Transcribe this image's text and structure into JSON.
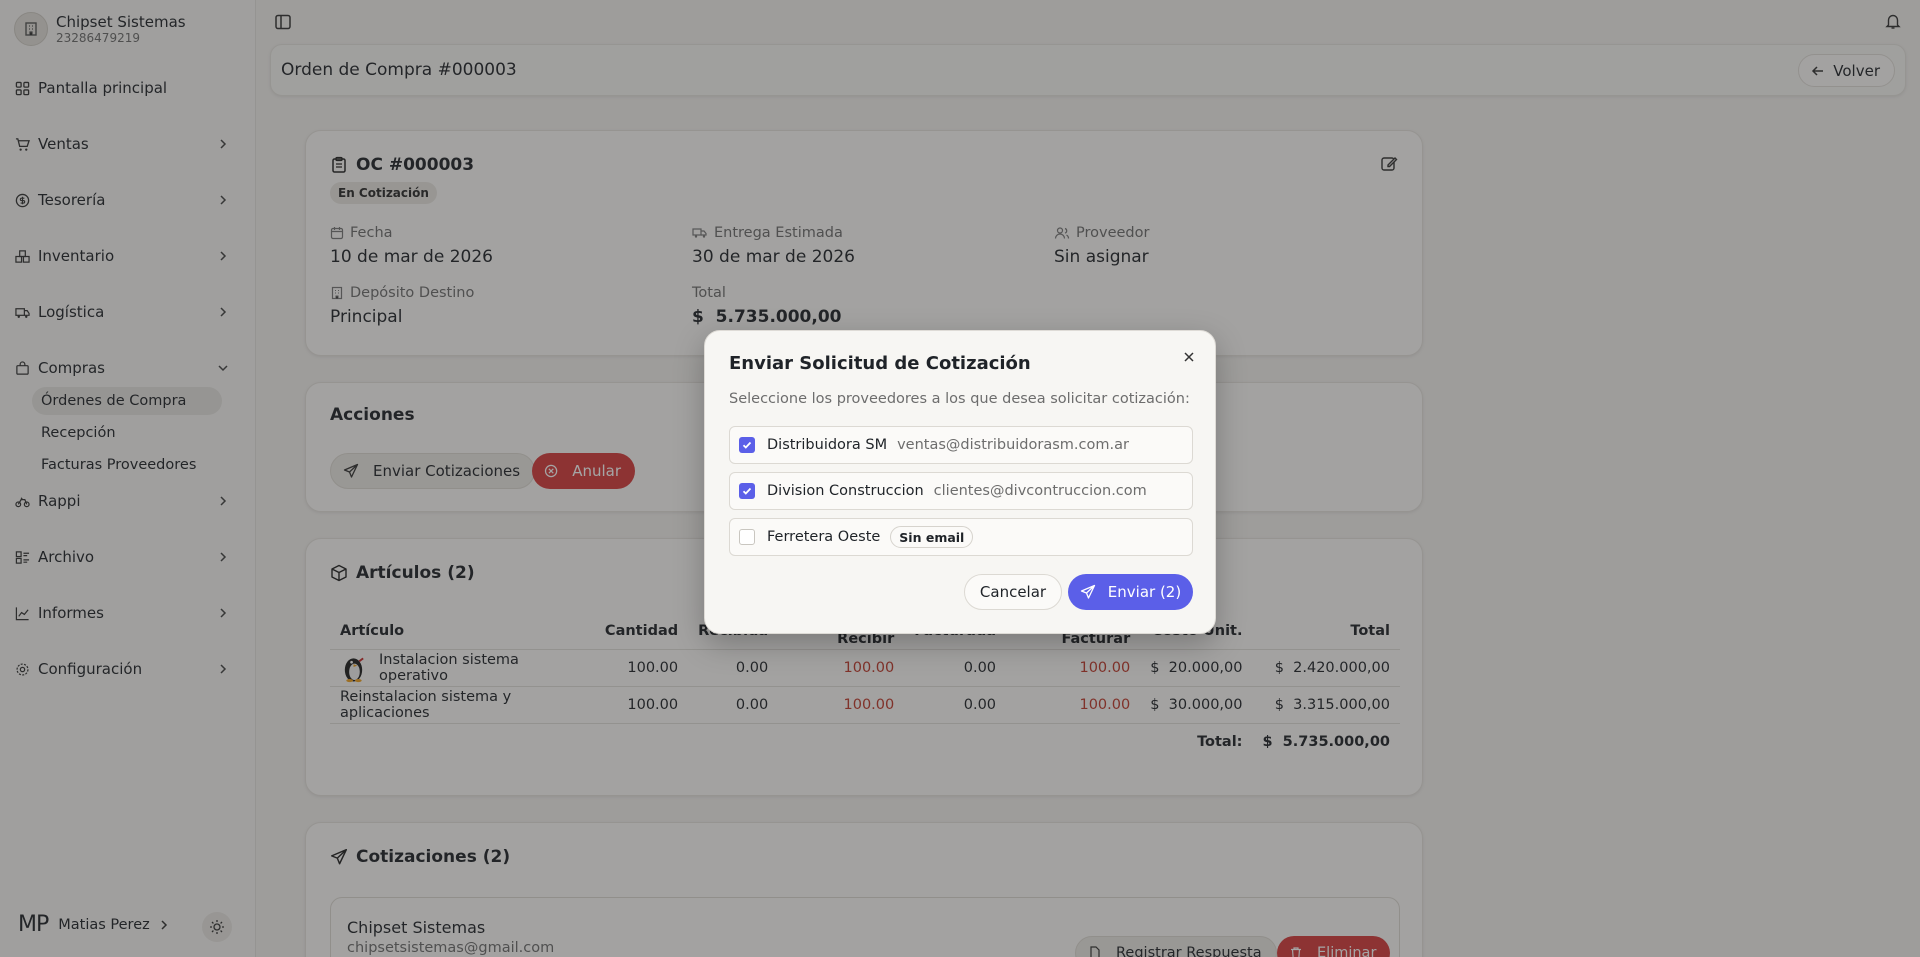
{
  "company": {
    "name": "Chipset Sistemas",
    "id": "23286479219"
  },
  "nav": {
    "items": [
      {
        "label": "Pantalla principal",
        "icon": "grid-icon"
      },
      {
        "label": "Ventas",
        "icon": "cart-icon"
      },
      {
        "label": "Tesorería",
        "icon": "dollar-icon"
      },
      {
        "label": "Inventario",
        "icon": "boxes-icon"
      },
      {
        "label": "Logística",
        "icon": "truck-icon"
      },
      {
        "label": "Compras",
        "icon": "bag-icon"
      },
      {
        "label": "Rappi",
        "icon": "bike-icon"
      },
      {
        "label": "Archivo",
        "icon": "archive-icon"
      },
      {
        "label": "Informes",
        "icon": "chart-icon"
      },
      {
        "label": "Configuración",
        "icon": "gear-icon"
      }
    ],
    "compras_sub": [
      "Órdenes de Compra",
      "Recepción",
      "Facturas Proveedores"
    ]
  },
  "user": {
    "initials": "MP",
    "name": "Matias Perez"
  },
  "header": {
    "title": "Orden de Compra #000003",
    "back_label": "Volver"
  },
  "order": {
    "title": "OC #000003",
    "status": "En Cotización",
    "fecha_label": "Fecha",
    "fecha": "10 de mar de 2026",
    "entrega_label": "Entrega Estimada",
    "entrega": "30 de mar de 2026",
    "proveedor_label": "Proveedor",
    "proveedor": "Sin asignar",
    "deposito_label": "Depósito Destino",
    "deposito": "Principal",
    "total_label": "Total",
    "total": "$  5.735.000,00"
  },
  "acciones": {
    "title": "Acciones",
    "enviar": "Enviar Cotizaciones",
    "anular": "Anular"
  },
  "articulos": {
    "title": "Artículos (2)",
    "headers": [
      "Artículo",
      "Cantidad",
      "Recibida",
      "Pend. Recibir",
      "Facturada",
      "Pend. Facturar",
      "Costo Unit.",
      "Total"
    ],
    "rows": [
      [
        "Instalacion sistema operativo",
        "100.00",
        "0.00",
        "100.00",
        "0.00",
        "100.00",
        "$  20.000,00",
        "$  2.420.000,00"
      ],
      [
        "Reinstalacion sistema y aplicaciones",
        "100.00",
        "0.00",
        "100.00",
        "0.00",
        "100.00",
        "$  30.000,00",
        "$  3.315.000,00"
      ]
    ],
    "total_label": "Total:",
    "total_value": "$  5.735.000,00"
  },
  "cotizaciones": {
    "title": "Cotizaciones (2)",
    "first": {
      "name": "Chipset Sistemas",
      "email": "chipsetsistemas@gmail.com",
      "register": "Registrar Respuesta",
      "delete": "Eliminar"
    }
  },
  "modal": {
    "title": "Enviar Solicitud de Cotización",
    "description": "Seleccione los proveedores a los que desea solicitar cotización:",
    "providers": [
      {
        "name": "Distribuidora SM",
        "email": "ventas@distribuidorasm.com.ar",
        "checked": true
      },
      {
        "name": "Division Construccion",
        "email": "clientes@divcontruccion.com",
        "checked": true
      },
      {
        "name": "Ferretera Oeste",
        "badge": "Sin email",
        "checked": false
      }
    ],
    "cancel": "Cancelar",
    "send": "Enviar (2)"
  },
  "colors": {
    "accent": "#5b5fe8",
    "danger": "#d63c3c",
    "overlay": "rgba(40,40,40,0.42)"
  }
}
